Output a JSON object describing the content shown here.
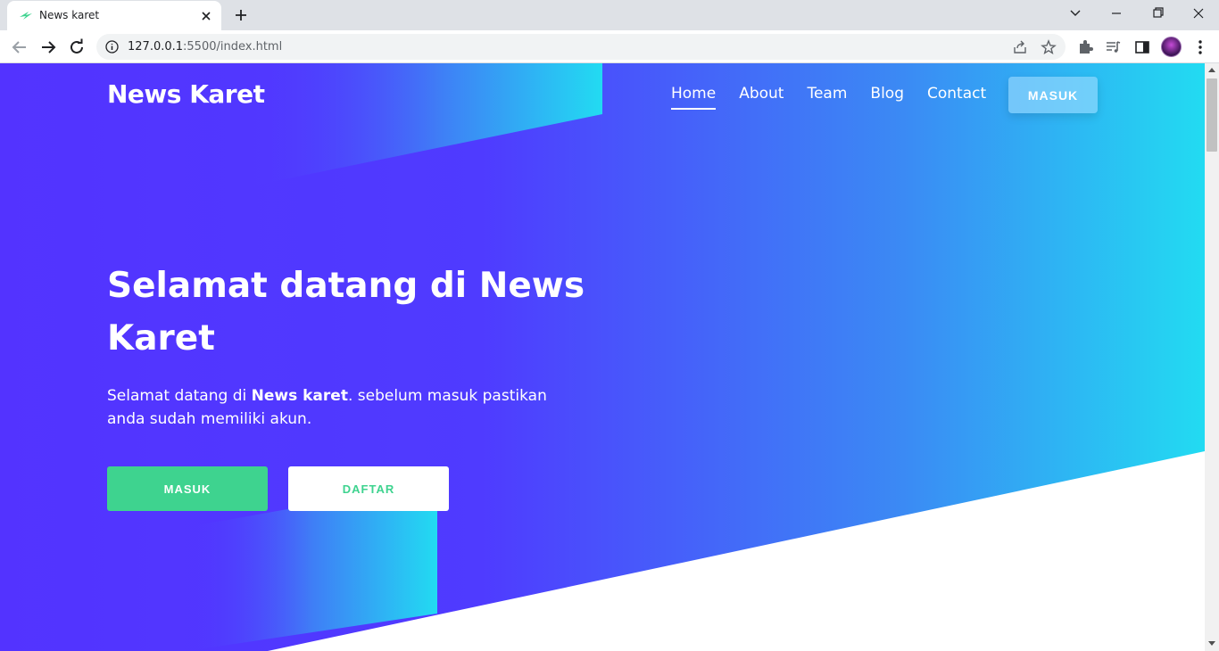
{
  "browser": {
    "tab_title": "News karet",
    "url_host": "127.0.0.1",
    "url_rest": ":5500/index.html"
  },
  "site": {
    "logo": "News Karet",
    "nav": [
      "Home",
      "About",
      "Team",
      "Blog",
      "Contact"
    ],
    "header_button": "MASUK"
  },
  "hero": {
    "title": "Selamat datang di News Karet",
    "text_prefix": "Selamat datang di ",
    "text_bold": "News karet",
    "text_suffix": ". sebelum masuk pastikan anda sudah memiliki akun.",
    "btn_masuk": "MASUK",
    "btn_daftar": "DAFTAR"
  },
  "colors": {
    "hero_start": "#5333ff",
    "hero_end": "#22dbf2",
    "accent_green": "#3ed38f"
  }
}
